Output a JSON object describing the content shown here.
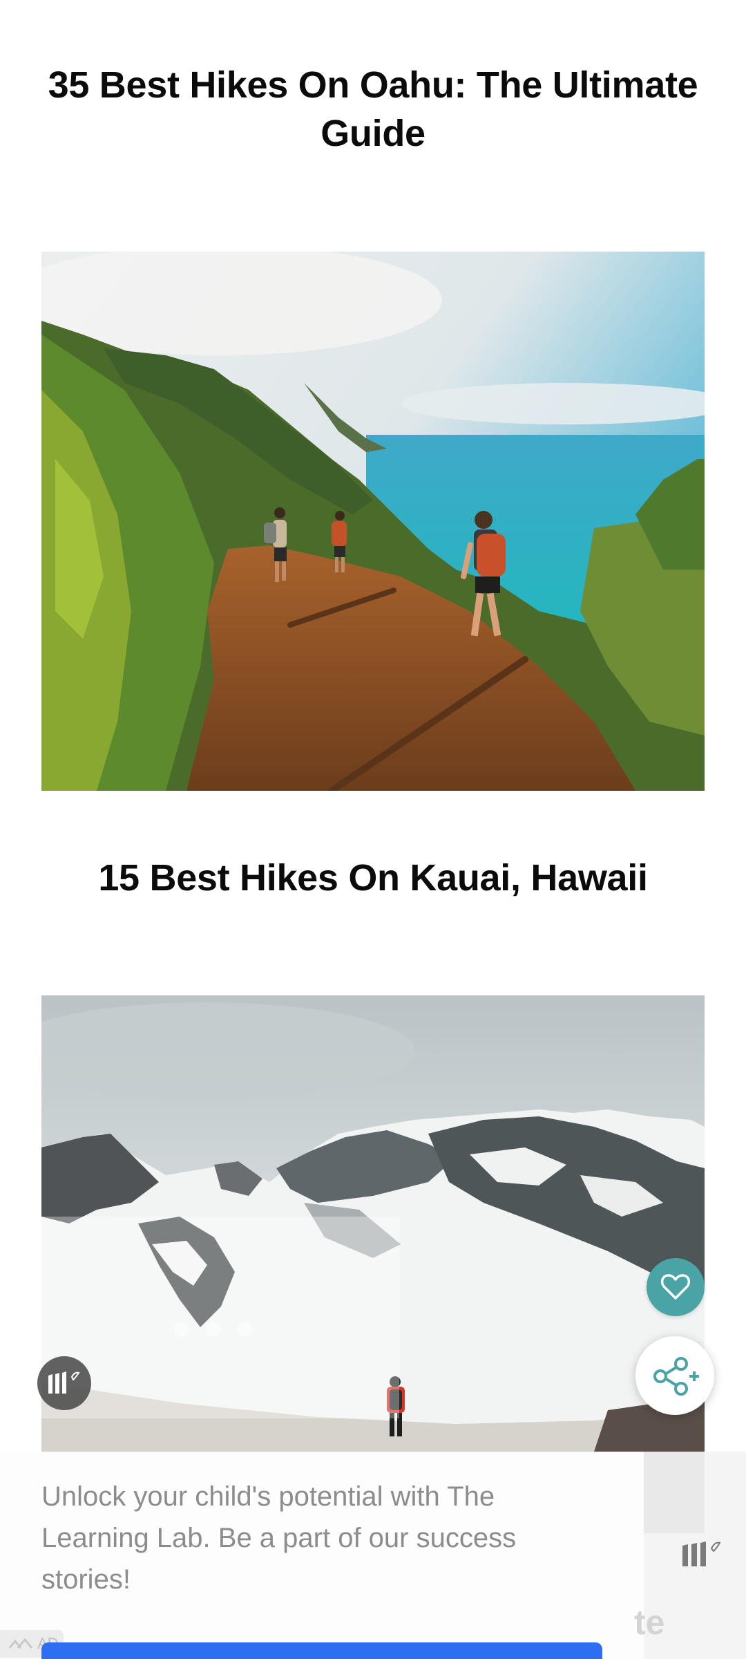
{
  "posts": [
    {
      "title": "35 Best Hikes On Oahu: The Ultimate Guide",
      "image": "hikers-on-coastal-cliff-trail-photo"
    },
    {
      "title": "15 Best Hikes On Kauai, Hawaii",
      "image": "hiker-in-snowy-mountains-photo"
    }
  ],
  "actions": {
    "favorite_icon": "heart-icon",
    "share_icon": "share-plus-icon"
  },
  "ad": {
    "text": "Unlock your child's potential with The Learning Lab. Be a part of our success stories!",
    "side_text": "te",
    "badge_label": "AD",
    "brand_icon": "mediavine-logo-icon"
  },
  "colors": {
    "accent_teal": "#4aa3a5",
    "cta_blue": "#2d6ef2",
    "title_text": "#0b0b0b",
    "ad_text": "#8c8c8c"
  }
}
